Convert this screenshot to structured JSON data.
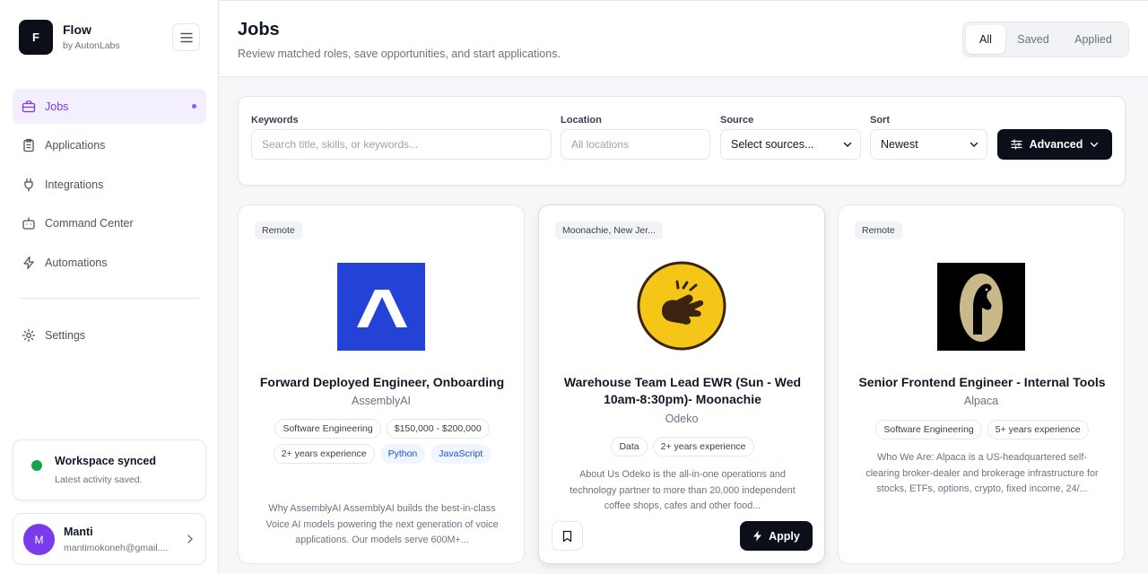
{
  "brand": {
    "logo_letter": "F",
    "name": "Flow",
    "sub": "by AutonLabs"
  },
  "sidebar": {
    "items": [
      {
        "label": "Jobs",
        "icon": "briefcase-icon",
        "active": true
      },
      {
        "label": "Applications",
        "icon": "clipboard-icon"
      },
      {
        "label": "Integrations",
        "icon": "plug-icon"
      },
      {
        "label": "Command Center",
        "icon": "bot-icon"
      },
      {
        "label": "Automations",
        "icon": "zap-icon"
      }
    ],
    "settings_label": "Settings"
  },
  "sync": {
    "title": "Workspace synced",
    "subtitle": "Latest activity saved.",
    "status_color": "#16a34a"
  },
  "user": {
    "initial": "M",
    "name": "Manti",
    "email": "mantimokoneh@gmail...."
  },
  "header": {
    "title": "Jobs",
    "subtitle": "Review matched roles, save opportunities, and start applications.",
    "tabs": [
      "All",
      "Saved",
      "Applied"
    ],
    "active_tab": "All"
  },
  "filters": {
    "keywords_label": "Keywords",
    "keywords_placeholder": "Search title, skills, or keywords...",
    "location_label": "Location",
    "location_placeholder": "All locations",
    "source_label": "Source",
    "source_value": "Select sources...",
    "sort_label": "Sort",
    "sort_value": "Newest",
    "advanced_label": "Advanced"
  },
  "jobs": [
    {
      "location": "Remote",
      "logo": "assemblyai-logo",
      "title": "Forward Deployed Engineer, Onboarding",
      "company": "AssemblyAI",
      "tags": [
        "Software Engineering",
        "$150,000 - $200,000",
        "2+ years experience"
      ],
      "skills": [
        "Python",
        "JavaScript"
      ],
      "description": "Why AssemblyAI AssemblyAI builds the best-in-class Voice AI models powering the next generation of voice applications. Our models serve 600M+..."
    },
    {
      "location": "Moonachie, New Jer...",
      "logo": "odeko-logo",
      "title": "Warehouse Team Lead EWR (Sun - Wed 10am-8:30pm)- Moonachie",
      "company": "Odeko",
      "tags": [
        "Data",
        "2+ years experience"
      ],
      "skills": [],
      "description": "About Us Odeko is the all-in-one operations and technology partner to more than 20,000 independent coffee shops, cafes and other food...",
      "apply_label": "Apply"
    },
    {
      "location": "Remote",
      "logo": "alpaca-logo",
      "title": "Senior Frontend Engineer - Internal Tools",
      "company": "Alpaca",
      "tags": [
        "Software Engineering",
        "5+ years experience"
      ],
      "skills": [],
      "description": "Who We Are: Alpaca is a US-headquartered self-clearing broker-dealer and brokerage infrastructure for stocks, ETFs, options, crypto, fixed income, 24/..."
    }
  ],
  "colors": {
    "accent": "#7c3aed",
    "primary_button": "#0b0f1a",
    "skill_tag_text": "#1d4ed8"
  }
}
